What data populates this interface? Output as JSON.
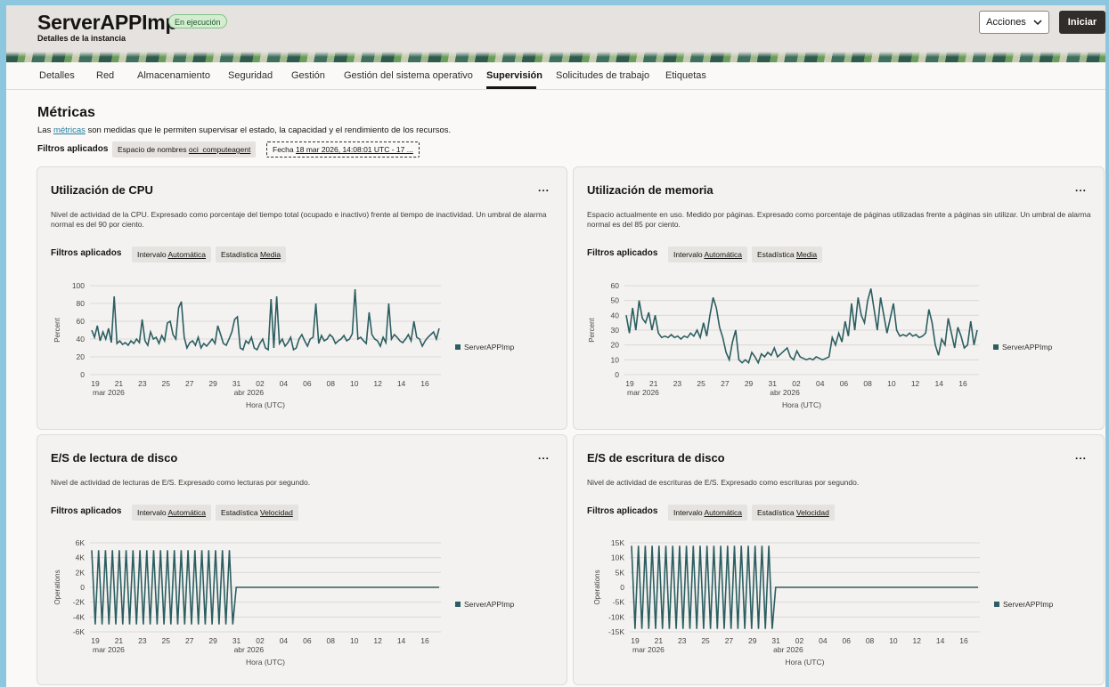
{
  "header": {
    "title": "ServerAPPImp",
    "status": "En ejecución",
    "subtitle": "Detalles de la instancia",
    "actions_label": "Acciones",
    "start_label": "Iniciar"
  },
  "tabs": [
    {
      "label": "Detalles"
    },
    {
      "label": "Red"
    },
    {
      "label": "Almacenamiento"
    },
    {
      "label": "Seguridad"
    },
    {
      "label": "Gestión"
    },
    {
      "label": "Gestión del sistema operativo"
    },
    {
      "label": "Supervisión",
      "active": true
    },
    {
      "label": "Solicitudes de trabajo"
    },
    {
      "label": "Etiquetas"
    }
  ],
  "metrics": {
    "title": "Métricas",
    "desc_prefix": "Las ",
    "desc_link": "métricas",
    "desc_suffix": " son medidas que le permiten supervisar el estado, la capacidad y el rendimiento de los recursos.",
    "filters_label": "Filtros aplicados",
    "namespace_label": "Espacio de nombres",
    "namespace_value": "oci_computeagent",
    "date_label": "Fecha",
    "date_value": "18 mar 2026, 14:08:01 UTC - 17 ..."
  },
  "colors": {
    "series": "#2c5e61",
    "accent_link": "#227e9e",
    "status_green": "#d4ecd0"
  },
  "cards": [
    {
      "title": "Utilización de CPU",
      "desc": "Nivel de actividad de la CPU. Expresado como porcentaje del tiempo total (ocupado e inactivo) frente al tiempo de inactividad. Un umbral de alarma normal es del 90 por ciento.",
      "filters_label": "Filtros aplicados",
      "interval_label": "Intervalo",
      "interval_value": "Automática",
      "stat_label": "Estadística",
      "stat_value": "Media",
      "menu": "...",
      "chart_data": {
        "type": "line",
        "ylabel": "Percent",
        "xlabel": "Hora (UTC)",
        "yticks": [
          "100",
          "80",
          "60",
          "40",
          "20",
          "0"
        ],
        "ylim": [
          0,
          100
        ],
        "xticks": [
          "19",
          "21",
          "23",
          "25",
          "27",
          "29",
          "31",
          "02",
          "04",
          "06",
          "08",
          "10",
          "12",
          "14",
          "16"
        ],
        "xsub": [
          "mar 2026",
          "abr 2026"
        ],
        "series": [
          {
            "name": "ServerAPPImp",
            "values": [
              50,
              42,
              55,
              38,
              48,
              40,
              52,
              36,
              88,
              35,
              38,
              34,
              36,
              33,
              38,
              35,
              40,
              36,
              62,
              38,
              33,
              48,
              40,
              42,
              35,
              44,
              38,
              58,
              60,
              45,
              40,
              75,
              82,
              42,
              30,
              36,
              38,
              33,
              42,
              30,
              35,
              32,
              36,
              40,
              35,
              55,
              45,
              35,
              33,
              40,
              48,
              62,
              65,
              30,
              28,
              38,
              35,
              42,
              30,
              28,
              35,
              40,
              30,
              28,
              85,
              30,
              88,
              35,
              40,
              32,
              36,
              42,
              28,
              30,
              40,
              45,
              38,
              32,
              40,
              42,
              80,
              35,
              44,
              38,
              40,
              45,
              42,
              35,
              38,
              40,
              44,
              38,
              40,
              46,
              96,
              40,
              42,
              38,
              35,
              70,
              45,
              40,
              38,
              32,
              42,
              36,
              80,
              40,
              45,
              42,
              38,
              36,
              40,
              45,
              38,
              60,
              42,
              40,
              32,
              38,
              42,
              45,
              48,
              40,
              52
            ]
          }
        ]
      }
    },
    {
      "title": "Utilización de memoria",
      "desc": "Espacio actualmente en uso. Medido por páginas. Expresado como porcentaje de páginas utilizadas frente a páginas sin utilizar. Un umbral de alarma normal es del 85 por ciento.",
      "filters_label": "Filtros aplicados",
      "interval_label": "Intervalo",
      "interval_value": "Automática",
      "stat_label": "Estadística",
      "stat_value": "Media",
      "menu": "...",
      "chart_data": {
        "type": "line",
        "ylabel": "Percent",
        "xlabel": "Hora (UTC)",
        "yticks": [
          "60",
          "50",
          "40",
          "30",
          "20",
          "10",
          "0"
        ],
        "ylim": [
          0,
          60
        ],
        "xticks": [
          "19",
          "21",
          "23",
          "25",
          "27",
          "29",
          "31",
          "02",
          "04",
          "06",
          "08",
          "10",
          "12",
          "14",
          "16"
        ],
        "xsub": [
          "mar 2026",
          "abr 2026"
        ],
        "series": [
          {
            "name": "ServerAPPImp",
            "values": [
              40,
              28,
              45,
              30,
              50,
              38,
              35,
              42,
              30,
              40,
              28,
              25,
              26,
              25,
              27,
              25,
              26,
              24,
              26,
              25,
              28,
              26,
              30,
              25,
              35,
              26,
              40,
              52,
              45,
              32,
              25,
              15,
              10,
              22,
              30,
              10,
              8,
              10,
              8,
              15,
              12,
              8,
              14,
              12,
              15,
              13,
              18,
              12,
              14,
              16,
              18,
              12,
              10,
              16,
              12,
              11,
              10,
              11,
              10,
              12,
              11,
              10,
              11,
              12,
              25,
              20,
              28,
              22,
              36,
              26,
              48,
              30,
              52,
              40,
              35,
              50,
              58,
              44,
              30,
              52,
              40,
              28,
              38,
              48,
              30,
              26,
              27,
              26,
              28,
              26,
              27,
              25,
              26,
              28,
              44,
              35,
              20,
              13,
              24,
              20,
              38,
              28,
              18,
              32,
              26,
              18,
              20,
              36,
              20,
              30
            ]
          }
        ]
      }
    },
    {
      "title": "E/S de lectura de disco",
      "desc": "Nivel de actividad de lecturas de E/S. Expresado como lecturas por segundo.",
      "filters_label": "Filtros aplicados",
      "interval_label": "Intervalo",
      "interval_value": "Automática",
      "stat_label": "Estadística",
      "stat_value": "Velocidad",
      "menu": "...",
      "chart_data": {
        "type": "line",
        "ylabel": "Operations",
        "xlabel": "Hora (UTC)",
        "yticks": [
          "6K",
          "4K",
          "2K",
          "0",
          "-2K",
          "-4K",
          "-6K"
        ],
        "ylim": [
          -6000,
          6000
        ],
        "xticks": [
          "19",
          "21",
          "23",
          "25",
          "27",
          "29",
          "31",
          "02",
          "04",
          "06",
          "08",
          "10",
          "12",
          "14",
          "16"
        ],
        "xsub": [
          "mar 2026",
          "abr 2026"
        ],
        "series": [
          {
            "name": "ServerAPPImp",
            "values": [
              5000,
              -5000,
              5000,
              -5000,
              5000,
              -5000,
              5000,
              -5000,
              5000,
              -5000,
              5000,
              -5000,
              5000,
              -5000,
              5000,
              -5000,
              5000,
              -5000,
              5000,
              -5000,
              5000,
              -5000,
              5000,
              -5000,
              5000,
              -5000,
              5000,
              -5000,
              5000,
              -5000,
              5000,
              -5000,
              5000,
              -5000,
              5000,
              -5000,
              5000,
              -5000,
              5000,
              -5000,
              5000,
              -5000,
              0,
              0,
              0,
              0,
              0,
              0,
              0,
              0,
              0,
              0,
              0,
              0,
              0,
              0,
              0,
              0,
              0,
              0,
              0,
              0,
              0,
              0,
              0,
              0,
              0,
              0,
              0,
              0,
              0,
              0,
              0,
              0,
              0,
              0,
              0,
              0,
              0,
              0,
              0,
              0,
              0,
              0,
              0,
              0,
              0,
              0,
              0,
              0,
              0,
              0,
              0,
              0,
              0,
              0,
              0,
              0,
              0,
              0,
              0,
              0
            ]
          }
        ]
      }
    },
    {
      "title": "E/S de escritura de disco",
      "desc": "Nivel de actividad de escrituras de E/S. Expresado como escrituras por segundo.",
      "filters_label": "Filtros aplicados",
      "interval_label": "Intervalo",
      "interval_value": "Automática",
      "stat_label": "Estadística",
      "stat_value": "Velocidad",
      "menu": "...",
      "chart_data": {
        "type": "line",
        "ylabel": "Operations",
        "xlabel": "Hora (UTC)",
        "yticks": [
          "15K",
          "10K",
          "5K",
          "0",
          "-5K",
          "-10K",
          "-15K"
        ],
        "ylim": [
          -15000,
          15000
        ],
        "xticks": [
          "19",
          "21",
          "23",
          "25",
          "27",
          "29",
          "31",
          "02",
          "04",
          "06",
          "08",
          "10",
          "12",
          "14",
          "16"
        ],
        "xsub": [
          "mar 2026",
          "abr 2026"
        ],
        "series": [
          {
            "name": "ServerAPPImp",
            "values": [
              14000,
              -14000,
              14000,
              -14000,
              14000,
              -14000,
              14000,
              -14000,
              14000,
              -14000,
              14000,
              -14000,
              14000,
              -14000,
              14000,
              -14000,
              14000,
              -14000,
              14000,
              -14000,
              14000,
              -14000,
              14000,
              -14000,
              14000,
              -14000,
              14000,
              -14000,
              14000,
              -14000,
              14000,
              -14000,
              14000,
              -14000,
              14000,
              -14000,
              14000,
              -14000,
              14000,
              -14000,
              14000,
              -14000,
              0,
              0,
              0,
              0,
              0,
              0,
              0,
              0,
              0,
              0,
              0,
              0,
              0,
              0,
              0,
              0,
              0,
              0,
              0,
              0,
              0,
              0,
              0,
              0,
              0,
              0,
              0,
              0,
              0,
              0,
              0,
              0,
              0,
              0,
              0,
              0,
              0,
              0,
              0,
              0,
              0,
              0,
              0,
              0,
              0,
              0,
              0,
              0,
              0,
              0,
              0,
              0,
              0,
              0,
              0,
              0,
              0,
              0,
              0,
              0
            ]
          }
        ]
      }
    }
  ]
}
